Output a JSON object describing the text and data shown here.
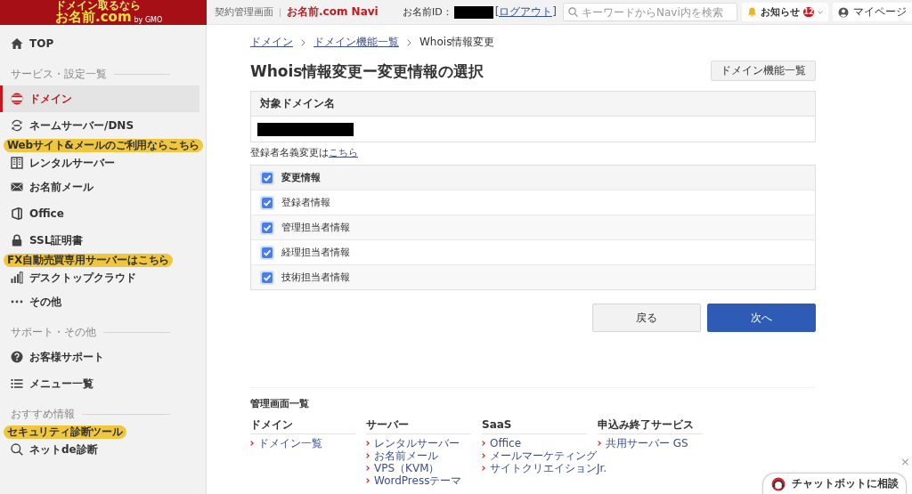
{
  "header": {
    "logo": {
      "tagline": "ドメイン取るなら",
      "name": "お名前.com",
      "byline": "by GMO"
    },
    "section": "契約管理画面",
    "app_name": "お名前.com Navi",
    "user": {
      "id_label": "お名前ID：",
      "logout": "[ログアウト]"
    },
    "search": {
      "placeholder": "キーワードからNavi内を検索"
    },
    "notifications": {
      "label": "お知らせ",
      "count": "12"
    },
    "mypage": {
      "label": "マイページ"
    }
  },
  "sidebar": {
    "top": {
      "label": "TOP",
      "selected": false
    },
    "sections": [
      {
        "title": "サービス・設定一覧",
        "items": [
          {
            "label": "ドメイン",
            "selected": true
          },
          {
            "label": "ネームサーバー/DNS",
            "selected": false
          },
          {
            "label": "レンタルサーバー",
            "badge": "Webサイト&メールのご利用ならこちら",
            "selected": false
          },
          {
            "label": "お名前メール",
            "selected": false
          },
          {
            "label": "Office",
            "selected": false
          },
          {
            "label": "SSL証明書",
            "selected": false
          },
          {
            "label": "デスクトップクラウド",
            "badge": "FX自動売買専用サーバーはこちら",
            "selected": false
          },
          {
            "label": "その他",
            "selected": false
          }
        ]
      },
      {
        "title": "サポート・その他",
        "items": [
          {
            "label": "お客様サポート",
            "selected": false
          },
          {
            "label": "メニュー一覧",
            "selected": false
          }
        ]
      },
      {
        "title": "おすすめ情報",
        "items": [
          {
            "label": "ネットde診断",
            "badge": "セキュリティ診断ツール",
            "selected": false
          }
        ]
      }
    ]
  },
  "breadcrumb": [
    {
      "label": "ドメイン",
      "kind": "link"
    },
    {
      "label": "ドメイン機能一覧",
      "kind": "link"
    },
    {
      "label": "Whois情報変更",
      "kind": "current"
    }
  ],
  "page_title": "Whois情報変更ー変更情報の選択",
  "title_button": "ドメイン機能一覧",
  "domain_table": {
    "header": "対象ドメイン名"
  },
  "note": {
    "text": "登録者名義変更は",
    "link": "こちら"
  },
  "change_table": {
    "header": {
      "label": "変更情報",
      "checked": true
    },
    "rows": [
      {
        "label": "登録者情報",
        "checked": true
      },
      {
        "label": "管理担当者情報",
        "checked": true
      },
      {
        "label": "経理担当者情報",
        "checked": true
      },
      {
        "label": "技術担当者情報",
        "checked": true
      }
    ]
  },
  "buttons": [
    {
      "label": "戻る",
      "kind": "secondary"
    },
    {
      "label": "次へ",
      "kind": "primary"
    }
  ],
  "footer": {
    "title": "管理画面一覧",
    "columns": [
      {
        "heading": "ドメイン",
        "links": [
          "ドメイン一覧"
        ]
      },
      {
        "heading": "サーバー",
        "links": [
          "レンタルサーバー",
          "お名前メール",
          "VPS（KVM）",
          "WordPressテーマ"
        ]
      },
      {
        "heading": "SaaS",
        "links": [
          "Office",
          "メールマーケティング",
          "サイトクリエイションJr."
        ]
      },
      {
        "heading": "申込み終了サービス",
        "links": [
          "共用サーバー GS"
        ]
      }
    ]
  },
  "chatbot": {
    "label": "チャットボットに相談",
    "close": "×"
  }
}
